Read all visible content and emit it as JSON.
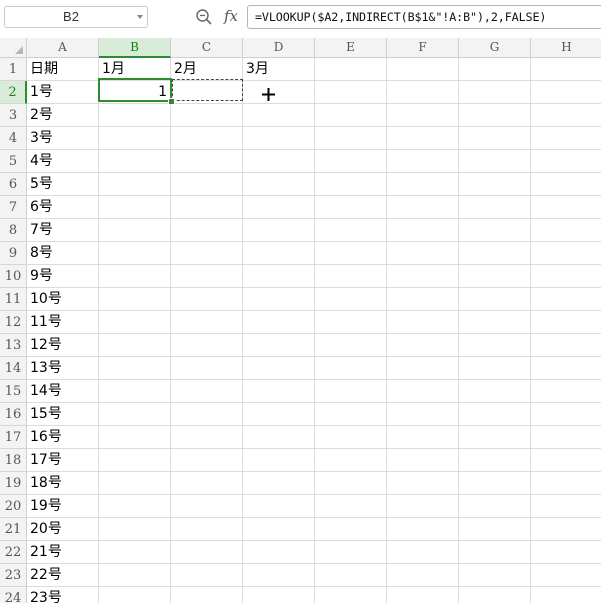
{
  "formula_bar": {
    "name_box": "B2",
    "fx_label": "fx",
    "formula": "=VLOOKUP($A2,INDIRECT(B$1&\"!A:B\"),2,FALSE)"
  },
  "columns": [
    "A",
    "B",
    "C",
    "D",
    "E",
    "F",
    "G",
    "H"
  ],
  "active_column": "B",
  "active_row": 2,
  "rows": [
    {
      "num": "1",
      "cells": {
        "A": "日期",
        "B": "1月",
        "C": "2月",
        "D": "3月"
      }
    },
    {
      "num": "2",
      "cells": {
        "A": "1号",
        "B": "1"
      }
    },
    {
      "num": "3",
      "cells": {
        "A": "2号"
      }
    },
    {
      "num": "4",
      "cells": {
        "A": "3号"
      }
    },
    {
      "num": "5",
      "cells": {
        "A": "4号"
      }
    },
    {
      "num": "6",
      "cells": {
        "A": "5号"
      }
    },
    {
      "num": "7",
      "cells": {
        "A": "6号"
      }
    },
    {
      "num": "8",
      "cells": {
        "A": "7号"
      }
    },
    {
      "num": "9",
      "cells": {
        "A": "8号"
      }
    },
    {
      "num": "10",
      "cells": {
        "A": "9号"
      }
    },
    {
      "num": "11",
      "cells": {
        "A": "10号"
      }
    },
    {
      "num": "12",
      "cells": {
        "A": "11号"
      }
    },
    {
      "num": "13",
      "cells": {
        "A": "12号"
      }
    },
    {
      "num": "14",
      "cells": {
        "A": "13号"
      }
    },
    {
      "num": "15",
      "cells": {
        "A": "14号"
      }
    },
    {
      "num": "16",
      "cells": {
        "A": "15号"
      }
    },
    {
      "num": "17",
      "cells": {
        "A": "16号"
      }
    },
    {
      "num": "18",
      "cells": {
        "A": "17号"
      }
    },
    {
      "num": "19",
      "cells": {
        "A": "18号"
      }
    },
    {
      "num": "20",
      "cells": {
        "A": "19号"
      }
    },
    {
      "num": "21",
      "cells": {
        "A": "20号"
      }
    },
    {
      "num": "22",
      "cells": {
        "A": "21号"
      }
    },
    {
      "num": "23",
      "cells": {
        "A": "22号"
      }
    },
    {
      "num": "24",
      "cells": {
        "A": "23号"
      }
    }
  ],
  "icons": {
    "zoom": "zoom-icon",
    "cursor": "plus-cursor-icon"
  },
  "colors": {
    "selection": "#2e8b2e",
    "header_bg": "#f3f3f3",
    "grid": "#dcdcdc"
  }
}
